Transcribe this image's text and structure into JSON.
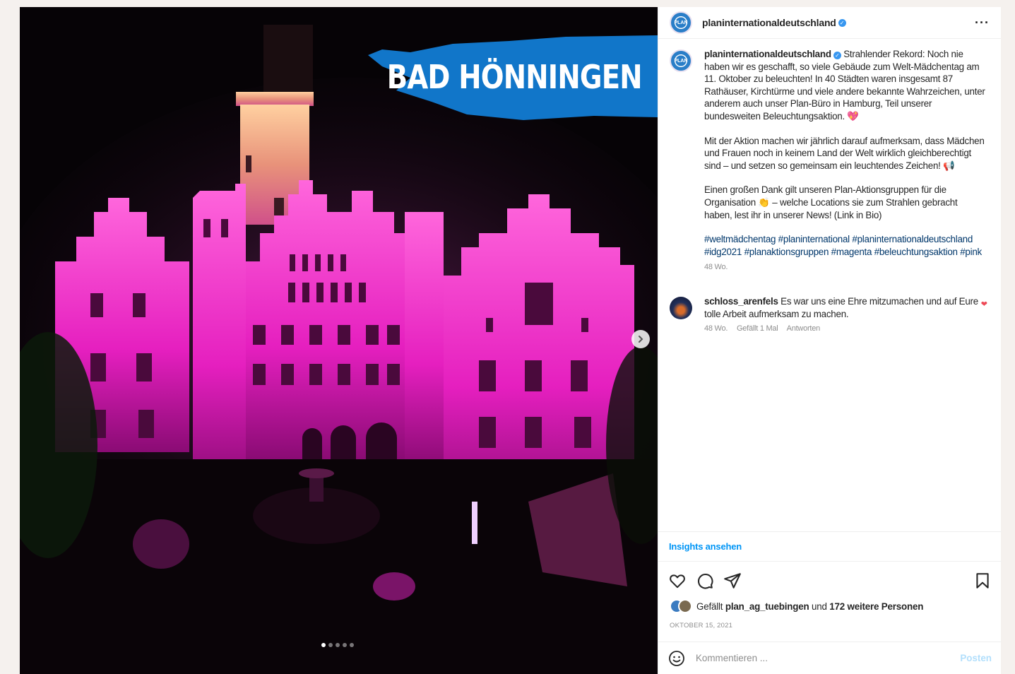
{
  "media": {
    "banner_text": "BAD HÖNNINGEN",
    "carousel_dots": 5,
    "active_dot": 0,
    "colors": {
      "sky": "#050205",
      "castle": "#e81fc0",
      "tower": "#f0a060",
      "banner": "#1176c9"
    }
  },
  "header": {
    "username": "planinternationaldeutschland",
    "verified": true,
    "more_label": "···"
  },
  "caption": {
    "username": "planinternationaldeutschland",
    "text1": "Strahlender Rekord: Noch nie haben wir es geschafft, so viele Gebäude zum Welt-Mädchentag am 11. Oktober zu beleuchten! In 40 Städten waren insgesamt 87 Rathäuser, Kirchtürme und viele andere bekannte Wahrzeichen, unter anderem auch unser Plan-Büro in Hamburg, Teil unserer bundesweiten Beleuchtungsaktion. 💖",
    "text2": "Mit der Aktion machen wir jährlich darauf aufmerksam, dass Mädchen und Frauen noch in keinem Land der Welt wirklich gleichberechtigt sind – und setzen so gemeinsam ein leuchtendes Zeichen! 📢",
    "text3": "Einen großen Dank gilt unseren Plan-Aktionsgruppen für die Organisation 👏 – welche Locations sie zum Strahlen gebracht haben, lest ihr in unserer News! (Link in Bio)",
    "hashtags": "#weltmädchentag #planinternational #planinternationaldeutschland #idg2021 #planaktionsgruppen #magenta #beleuchtungsaktion #pink",
    "time": "48 Wo."
  },
  "comment": {
    "username": "schloss_arenfels",
    "text": "Es war uns eine Ehre mitzumachen und auf Eure tolle Arbeit aufmerksam zu machen.",
    "time": "48 Wo.",
    "likes": "Gefällt 1 Mal",
    "reply": "Antworten"
  },
  "insights": "Insights ansehen",
  "likes": {
    "prefix": "Gefällt",
    "user": "plan_ag_tuebingen",
    "middle": "und",
    "others": "172 weitere Personen"
  },
  "date": "OKTOBER 15, 2021",
  "compose": {
    "placeholder": "Kommentieren ...",
    "post_label": "Posten"
  }
}
